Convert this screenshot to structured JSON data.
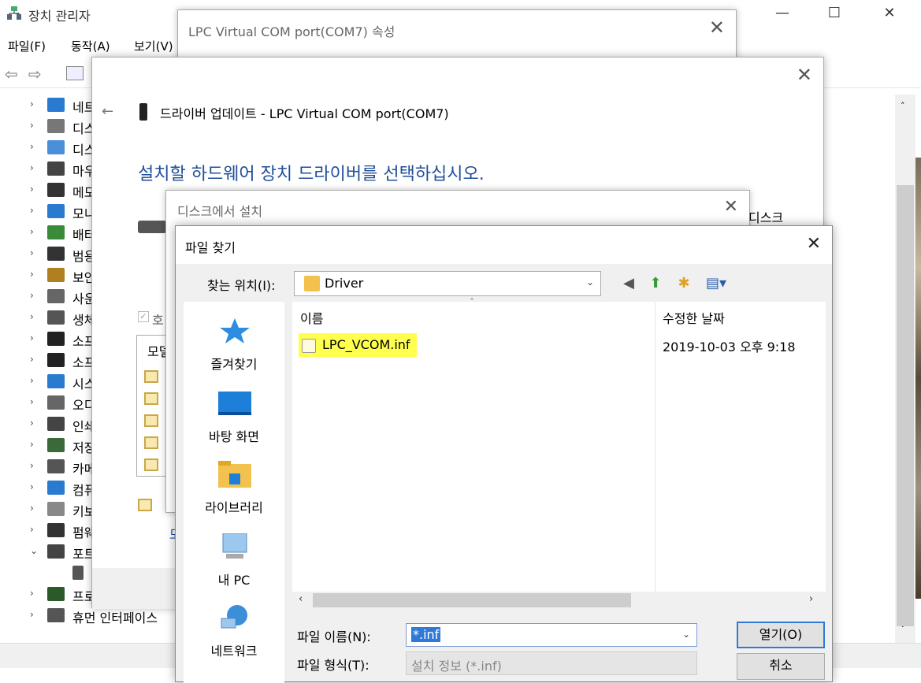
{
  "device_manager": {
    "title": "장치 관리자",
    "window_controls": {
      "minimize": "—",
      "maximize": "☐",
      "close": "✕"
    },
    "menu": [
      "파일(F)",
      "동작(A)",
      "보기(V)"
    ],
    "tree": [
      {
        "label": "네트",
        "expanded": false
      },
      {
        "label": "디스",
        "expanded": false
      },
      {
        "label": "디스",
        "expanded": false
      },
      {
        "label": "마우",
        "expanded": false
      },
      {
        "label": "메모",
        "expanded": false
      },
      {
        "label": "모니",
        "expanded": false
      },
      {
        "label": "배터",
        "expanded": false
      },
      {
        "label": "범용",
        "expanded": false
      },
      {
        "label": "보안",
        "expanded": false
      },
      {
        "label": "사운",
        "expanded": false
      },
      {
        "label": "생체",
        "expanded": false
      },
      {
        "label": "소프",
        "expanded": false
      },
      {
        "label": "소프",
        "expanded": false
      },
      {
        "label": "시스",
        "expanded": false
      },
      {
        "label": "오디",
        "expanded": false
      },
      {
        "label": "인쇄",
        "expanded": false
      },
      {
        "label": "저장",
        "expanded": false
      },
      {
        "label": "카메",
        "expanded": false
      },
      {
        "label": "컴퓨",
        "expanded": false
      },
      {
        "label": "키보",
        "expanded": false
      },
      {
        "label": "펌웨",
        "expanded": false
      },
      {
        "label": "포트",
        "expanded": true
      },
      {
        "label": "",
        "expanded": null
      },
      {
        "label": "프로",
        "expanded": false
      },
      {
        "label": "휴먼 인터페이스",
        "expanded": false
      }
    ]
  },
  "props_dialog": {
    "title": "LPC Virtual COM port(COM7) 속성",
    "close": "✕"
  },
  "wizard": {
    "close": "✕",
    "back": "←",
    "header": "드라이버 업데이트 - LPC Virtual COM port(COM7)",
    "subtitle": "설치할 하드웨어 장치 드라이버를 선택하십시오.",
    "checkbox_label": "호",
    "list_header": "모델",
    "link_char": "모"
  },
  "disk_dialog": {
    "title": "디스크에서 설치",
    "close": "✕",
    "side_text": "디스크"
  },
  "file_dialog": {
    "title": "파일 찾기",
    "close": "✕",
    "look_in_label": "찾는 위치(I):",
    "look_in_value": "Driver",
    "toolbar": {
      "back": "◀",
      "up": "⬆",
      "new_folder": "✱",
      "view": "▤▾"
    },
    "places": [
      "즐겨찾기",
      "바탕 화면",
      "라이브러리",
      "내 PC",
      "네트워크"
    ],
    "columns": {
      "name": "이름",
      "modified": "수정한 날짜"
    },
    "files": [
      {
        "name": "LPC_VCOM.inf",
        "modified": "2019-10-03 오후 9:18"
      }
    ],
    "filename_label": "파일 이름(N):",
    "filename_value": "*.inf",
    "filetype_label": "파일 형식(T):",
    "filetype_value": "설치 정보 (*.inf)",
    "open_button": "열기(O)",
    "cancel_button": "취소"
  }
}
